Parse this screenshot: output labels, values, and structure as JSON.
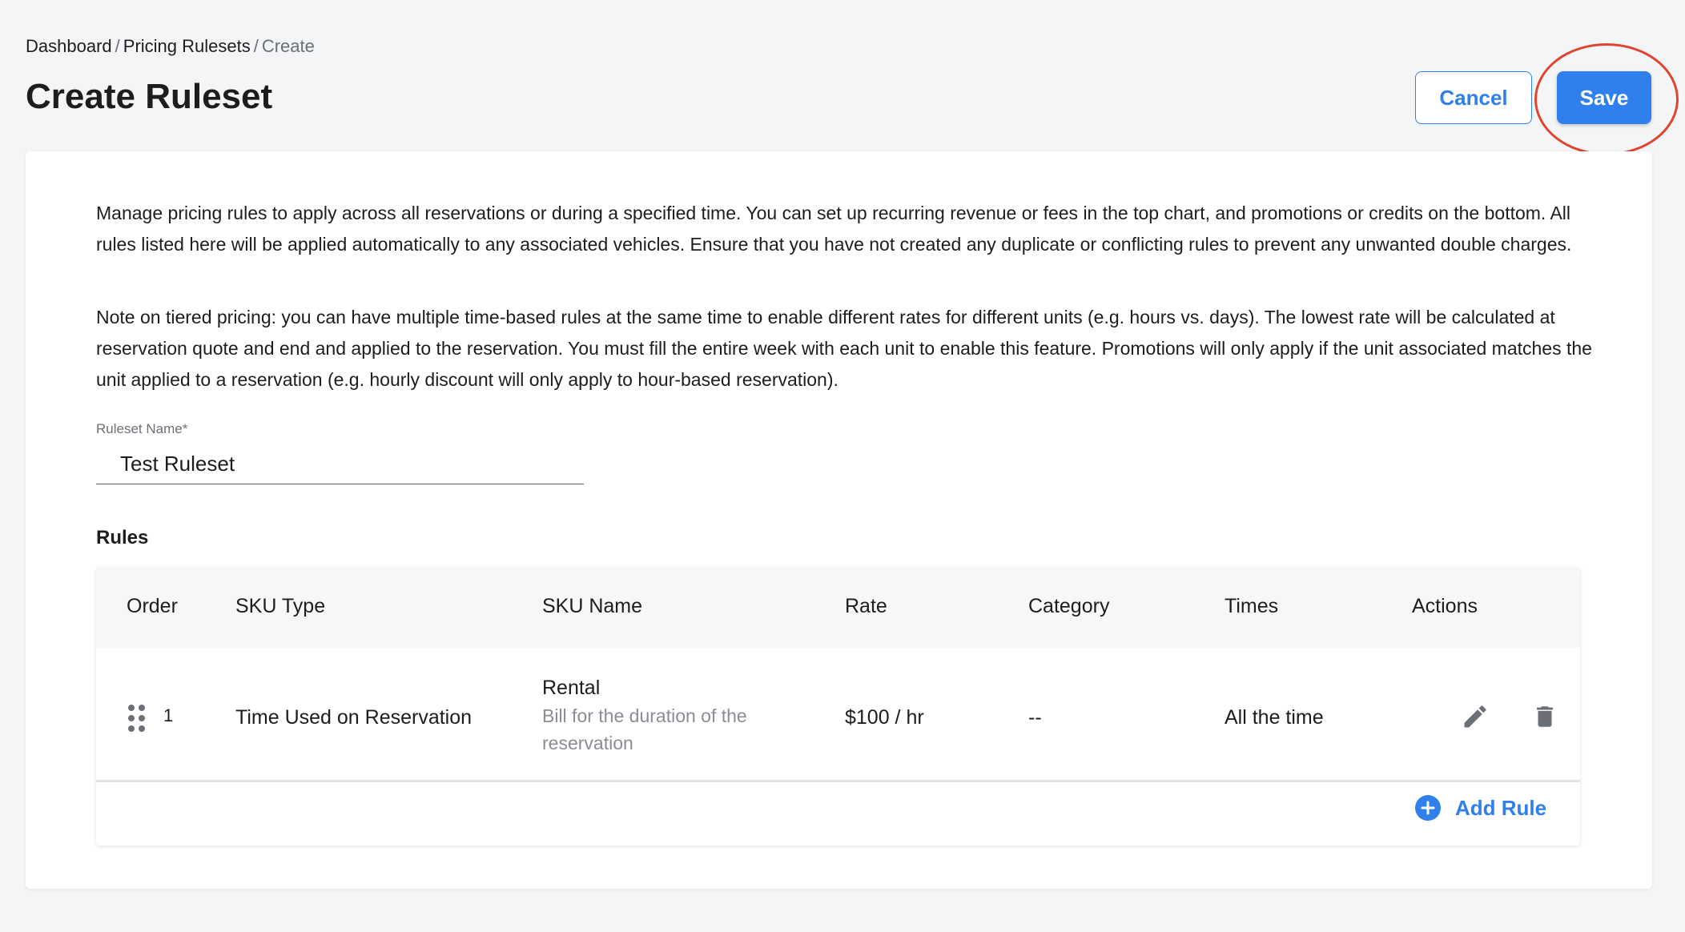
{
  "breadcrumb": {
    "items": [
      "Dashboard",
      "Pricing Rulesets",
      "Create"
    ],
    "separator": "/"
  },
  "header": {
    "title": "Create Ruleset",
    "cancel_label": "Cancel",
    "save_label": "Save"
  },
  "description": {
    "paragraph_1": "Manage pricing rules to apply across all reservations or during a specified time. You can set up recurring revenue or fees in the top chart, and promotions or credits on the bottom. All rules listed here will be applied automatically to any associated vehicles. Ensure that you have not created any duplicate or conflicting rules to prevent any unwanted double charges.",
    "paragraph_2": "Note on tiered pricing: you can have multiple time-based rules at the same time to enable different rates for different units (e.g. hours vs. days). The lowest rate will be calculated at reservation quote and end and applied to the reservation. You must fill the entire week with each unit to enable this feature. Promotions will only apply if the unit associated matches the unit applied to a reservation (e.g. hourly discount will only apply to hour-based reservation)."
  },
  "ruleset_name": {
    "label": "Ruleset Name*",
    "value": "Test Ruleset"
  },
  "rules": {
    "title": "Rules",
    "columns": [
      "Order",
      "SKU Type",
      "SKU Name",
      "Rate",
      "Category",
      "Times",
      "Actions"
    ],
    "rows": [
      {
        "order": "1",
        "sku_type": "Time Used on Reservation",
        "sku_name": "Rental",
        "sku_description": "Bill for the duration of the reservation",
        "rate": "$100 / hr",
        "category": "--",
        "times": "All the time"
      }
    ],
    "add_rule_label": "Add Rule"
  },
  "colors": {
    "accent": "#2f80ed",
    "annotation": "#e0442f",
    "background": "#f4f5f7"
  },
  "icons": {
    "drag": "drag-handle-icon",
    "edit": "pencil-icon",
    "delete": "trash-icon",
    "add": "plus-circle-icon"
  }
}
